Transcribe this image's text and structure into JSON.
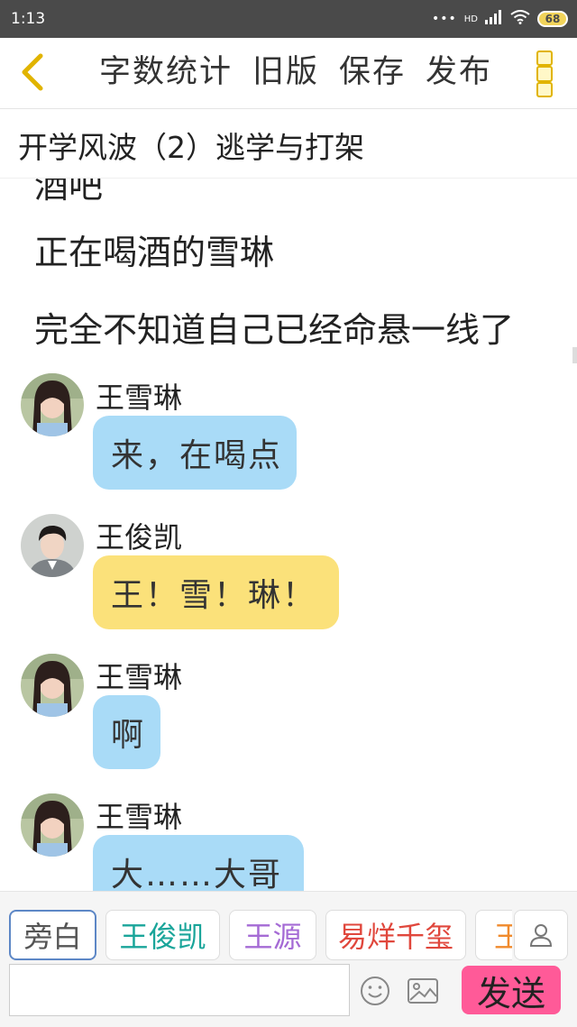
{
  "status": {
    "time": "1:13",
    "battery": "68",
    "network": "HD"
  },
  "toolbar": {
    "word_count_label": "字数统计",
    "old_version_label": "旧版",
    "save_label": "保存",
    "publish_label": "发布"
  },
  "story_title": "开学风波（2）逃学与打架",
  "narration": {
    "cut_line": "酒吧",
    "lines": [
      "正在喝酒的雪琳",
      "完全不知道自己已经命悬一线了"
    ]
  },
  "messages": [
    {
      "sender": "王雪琳",
      "text": "来，在喝点"
    },
    {
      "sender": "王俊凯",
      "text": "王！雪！琳！"
    },
    {
      "sender": "王雪琳",
      "text": "啊"
    },
    {
      "sender": "王雪琳",
      "text": "大……大哥"
    }
  ],
  "characters": [
    {
      "name": "旁白",
      "color": "#555555"
    },
    {
      "name": "王俊凯",
      "color": "#1aa59a"
    },
    {
      "name": "王源",
      "color": "#a56bd5"
    },
    {
      "name": "易烊千玺",
      "color": "#e0473c"
    },
    {
      "name": "王",
      "color": "#f08a2c"
    }
  ],
  "input": {
    "placeholder": ""
  },
  "send_label": "发送",
  "colors": {
    "blue_bubble": "#a9dbf7",
    "yellow_bubble": "#fbe17a",
    "send_button": "#ff5a98",
    "accent": "#e1b400"
  },
  "icons": [
    "back-arrow-icon",
    "more-icon",
    "user-icon",
    "emoji-icon",
    "image-icon"
  ]
}
